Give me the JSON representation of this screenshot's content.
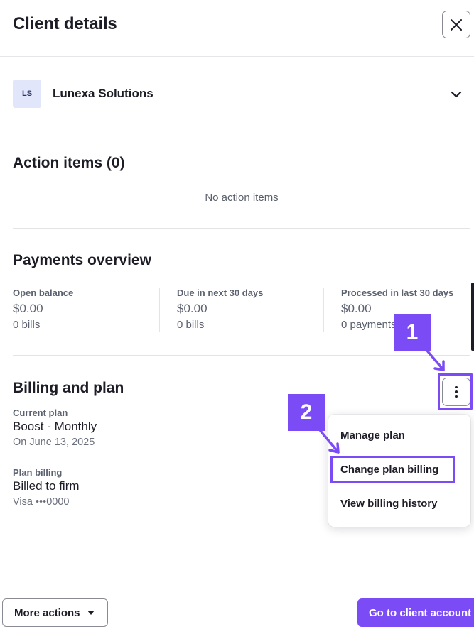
{
  "header": {
    "title": "Client details"
  },
  "client": {
    "initials": "LS",
    "name": "Lunexa Solutions"
  },
  "action_items": {
    "title": "Action items (0)",
    "empty": "No action items"
  },
  "payments": {
    "title": "Payments overview",
    "metrics": [
      {
        "label": "Open balance",
        "value": "$0.00",
        "sub": "0 bills"
      },
      {
        "label": "Due in next 30 days",
        "value": "$0.00",
        "sub": "0 bills"
      },
      {
        "label": "Processed in last 30 days",
        "value": "$0.00",
        "sub": "0 payments"
      }
    ]
  },
  "billing": {
    "title": "Billing and plan",
    "current_plan_label": "Current plan",
    "current_plan_value": "Boost - Monthly",
    "current_plan_date": "On June 13, 2025",
    "plan_billing_label": "Plan billing",
    "plan_billing_value": "Billed to firm",
    "plan_billing_card": "Visa •••0000"
  },
  "menu": {
    "items": [
      {
        "label": "Manage plan"
      },
      {
        "label": "Change plan billing"
      },
      {
        "label": "View billing history"
      }
    ]
  },
  "annotations": {
    "step1": "1",
    "step2": "2",
    "color": "#7b4cf6"
  },
  "footer": {
    "more_actions": "More actions",
    "go_to_client": "Go to client account"
  },
  "icons": {
    "close": "close-icon",
    "chevron": "chevron-down-icon",
    "kebab": "more-vertical-icon",
    "caret": "caret-down-icon"
  }
}
